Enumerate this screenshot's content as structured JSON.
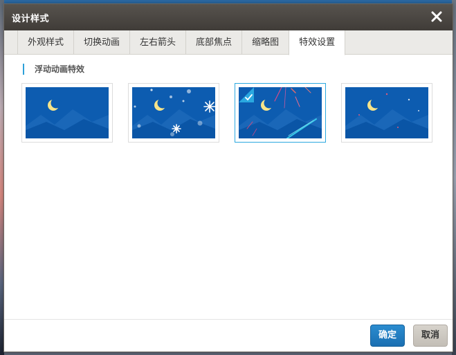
{
  "dialog": {
    "title": "设计样式"
  },
  "tabs": [
    {
      "label": "外观样式",
      "active": false
    },
    {
      "label": "切换动画",
      "active": false
    },
    {
      "label": "左右箭头",
      "active": false
    },
    {
      "label": "底部焦点",
      "active": false
    },
    {
      "label": "缩略图",
      "active": false
    },
    {
      "label": "特效设置",
      "active": true
    }
  ],
  "section": {
    "label": "浮动动画特效"
  },
  "effects": [
    {
      "icon": "night-landscape-plain",
      "selected": false
    },
    {
      "icon": "night-landscape-snowflakes",
      "selected": false
    },
    {
      "icon": "night-landscape-meteors",
      "selected": true
    },
    {
      "icon": "night-landscape-sparkles",
      "selected": false
    }
  ],
  "footer": {
    "ok_label": "确定",
    "cancel_label": "取消"
  },
  "colors": {
    "titlebar": "#4a4642",
    "accent": "#2da0d8",
    "primary_button": "#1f7ec4",
    "scene_sky": "#0d5cb0",
    "scene_mountain": "#1a67b8",
    "moon": "#f6e48a"
  }
}
